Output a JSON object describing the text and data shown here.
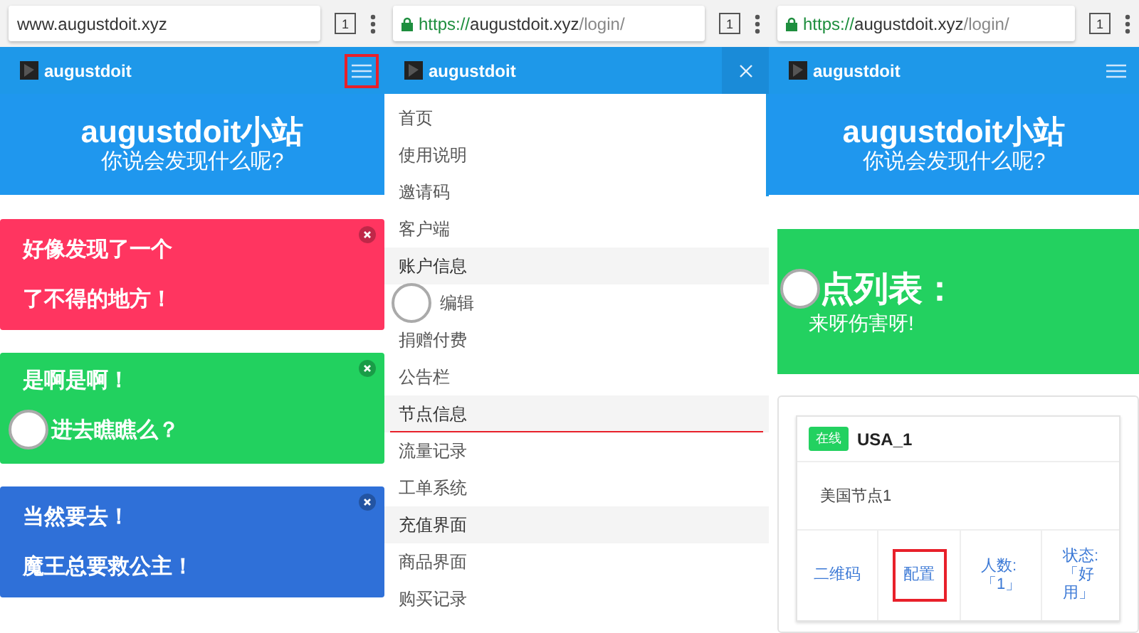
{
  "screens": [
    {
      "kind": "home",
      "address_bar": {
        "secure": false,
        "host": "www.augustdoit.xyz"
      },
      "tab_count": "1",
      "brand": "augustdoit",
      "menu_highlighted": true,
      "hero": {
        "title": "augustdoit小站",
        "subtitle": "你说会发现什么呢?"
      },
      "alerts": [
        {
          "color": "#ff3560",
          "touched": false,
          "lines": [
            "好像发现了一个",
            "了不得的地方！"
          ]
        },
        {
          "color": "#22d15f",
          "touched": true,
          "lines": [
            "是啊是啊！",
            "进去瞧瞧么？"
          ]
        },
        {
          "color": "#2f70d8",
          "touched": false,
          "lines": [
            "当然要去！",
            "魔王总要救公主！"
          ]
        }
      ]
    },
    {
      "kind": "menu",
      "address_bar": {
        "secure": true,
        "scheme": "https://",
        "host": "augustdoit.xyz",
        "path": "/login/"
      },
      "tab_count": "1",
      "brand": "augustdoit",
      "items": [
        {
          "kind": "link",
          "label": "首页",
          "underlined": false,
          "touched": false
        },
        {
          "kind": "link",
          "label": "使用说明",
          "underlined": false,
          "touched": false
        },
        {
          "kind": "link",
          "label": "邀请码",
          "underlined": false,
          "touched": false
        },
        {
          "kind": "link",
          "label": "客户端",
          "underlined": false,
          "touched": false
        },
        {
          "kind": "section",
          "label": "账户信息",
          "underlined": false,
          "touched": false
        },
        {
          "kind": "link",
          "label": "编辑",
          "underlined": false,
          "touched": true
        },
        {
          "kind": "link",
          "label": "捐赠付费",
          "underlined": false,
          "touched": false
        },
        {
          "kind": "link",
          "label": "公告栏",
          "underlined": false,
          "touched": false
        },
        {
          "kind": "section",
          "label": "节点信息",
          "underlined": true,
          "touched": false
        },
        {
          "kind": "link",
          "label": "流量记录",
          "underlined": false,
          "touched": false
        },
        {
          "kind": "link",
          "label": "工单系统",
          "underlined": false,
          "touched": false
        },
        {
          "kind": "section",
          "label": "充值界面",
          "underlined": false,
          "touched": false
        },
        {
          "kind": "link",
          "label": "商品界面",
          "underlined": false,
          "touched": false
        },
        {
          "kind": "link",
          "label": "购买记录",
          "underlined": false,
          "touched": false
        }
      ]
    },
    {
      "kind": "nodes",
      "address_bar": {
        "secure": true,
        "scheme": "https://",
        "host": "augustdoit.xyz",
        "path": "/login/"
      },
      "tab_count": "1",
      "brand": "augustdoit",
      "menu_highlighted": false,
      "hero": {
        "title": "augustdoit小站",
        "subtitle": "你说会发现什么呢?"
      },
      "banner": {
        "title": "点列表：",
        "subtitle": "来呀伤害呀!",
        "touched": true
      },
      "node": {
        "status": "在线",
        "name": "USA_1",
        "description": "美国节点1",
        "actions": [
          {
            "lines": [
              "二维码"
            ],
            "highlighted": false
          },
          {
            "lines": [
              "配置"
            ],
            "highlighted": true
          },
          {
            "lines": [
              "人数:",
              "「1」"
            ],
            "highlighted": false
          },
          {
            "lines": [
              "状态:",
              "「好",
              "用」"
            ],
            "highlighted": false
          }
        ]
      }
    }
  ]
}
